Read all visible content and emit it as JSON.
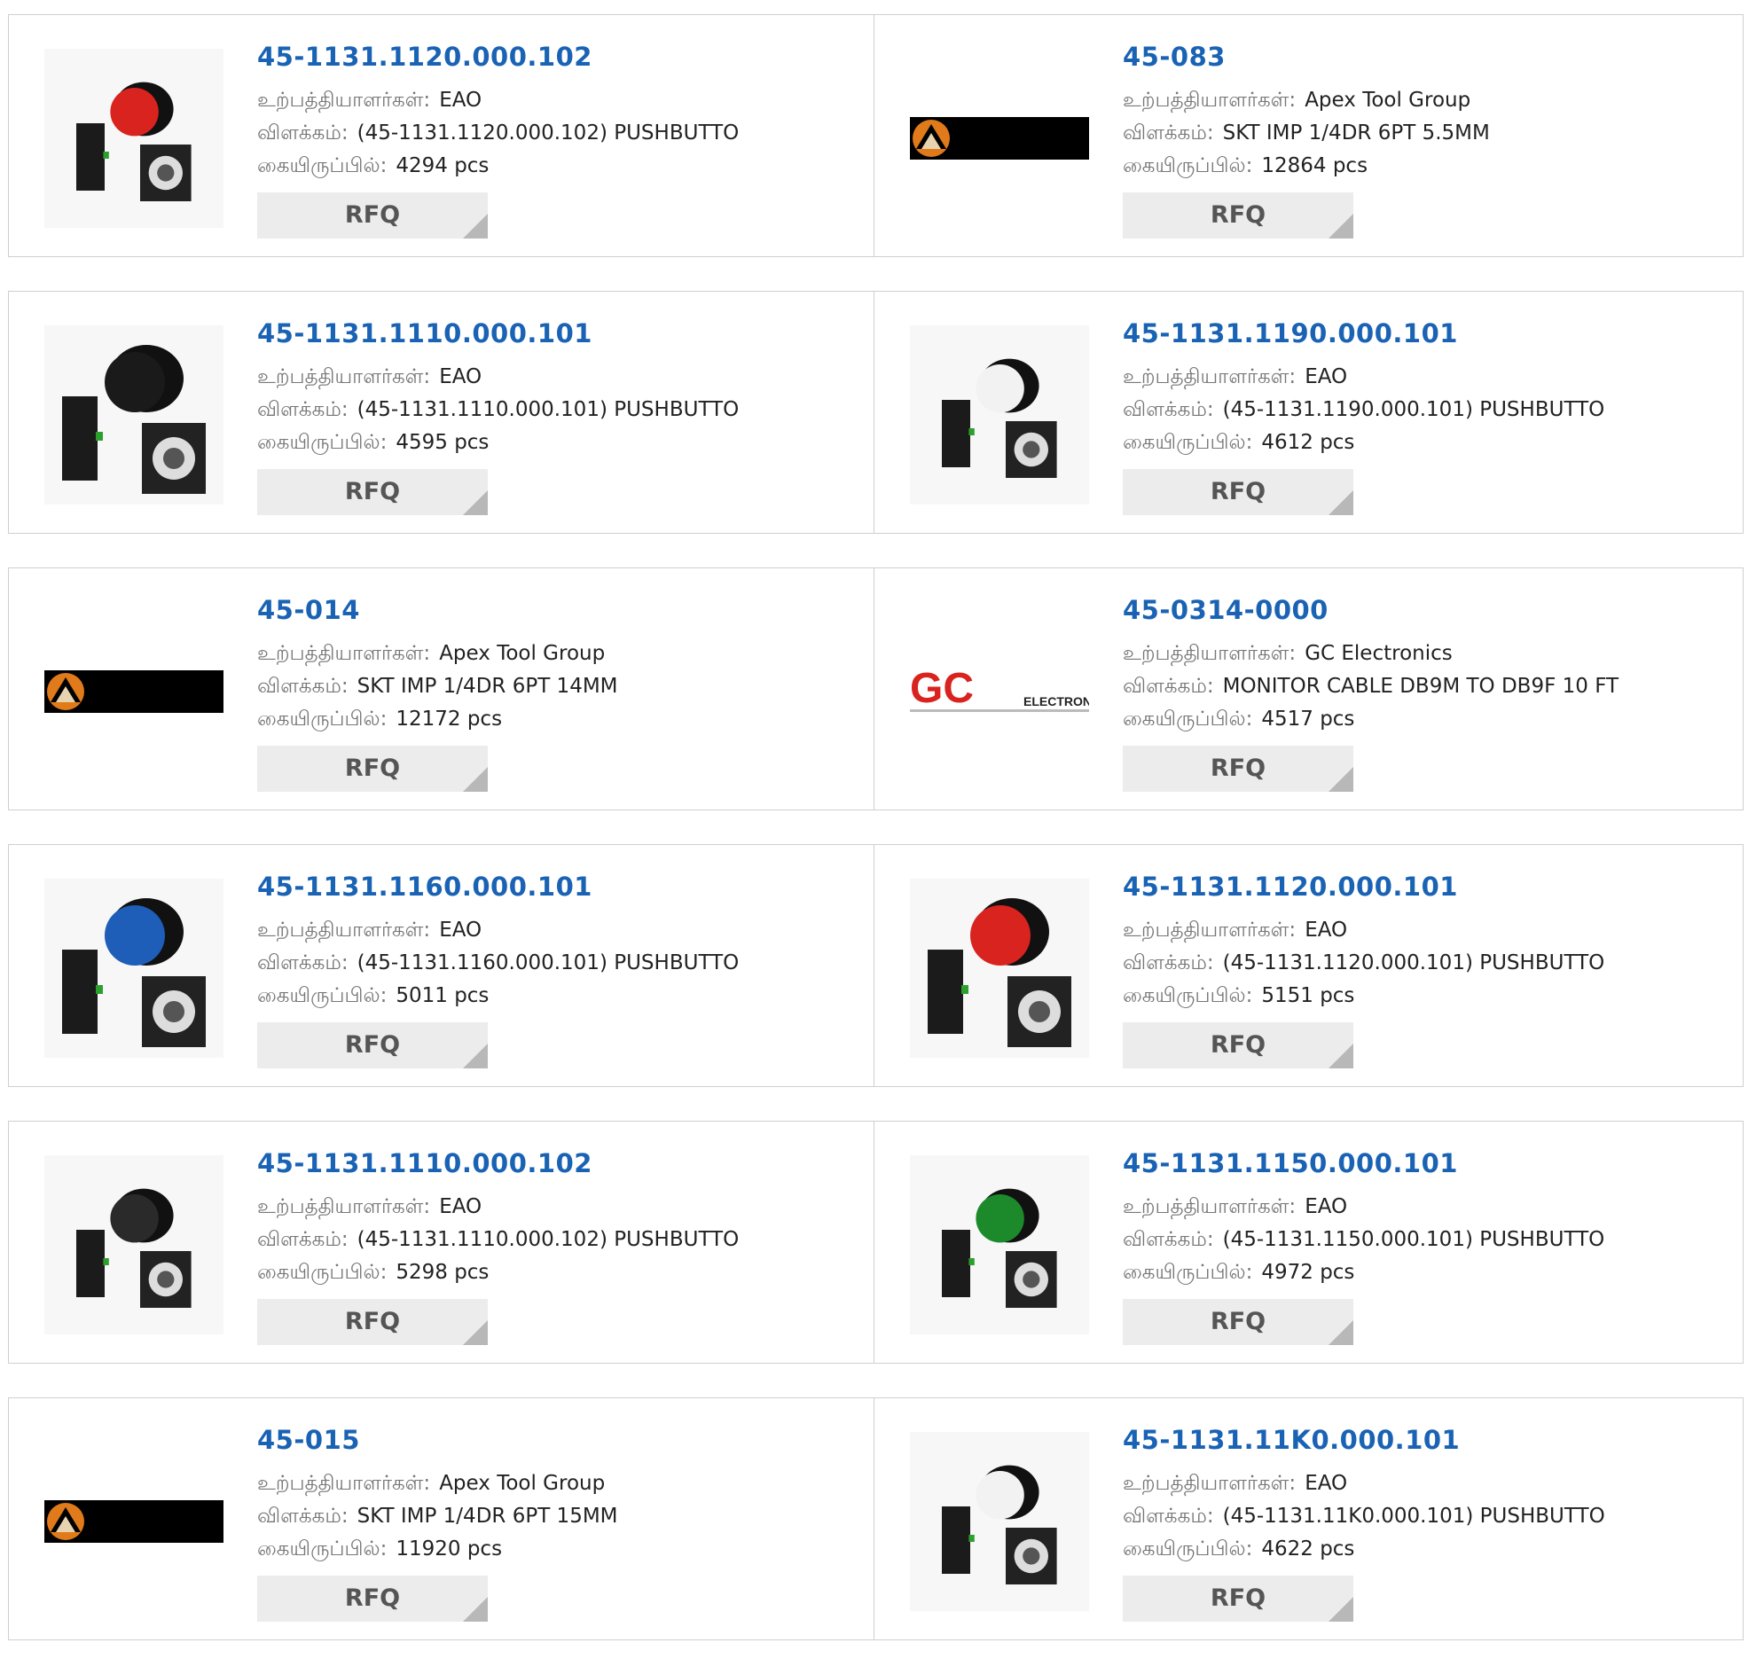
{
  "labels": {
    "manufacturer": "உற்பத்தியாளர்கள்:",
    "description": "விளக்கம்:",
    "stock": "கையிருப்பில்:",
    "rfq": "RFQ"
  },
  "products": [
    {
      "part": "45-1131.1120.000.102",
      "manufacturer": "EAO",
      "description": "(45-1131.1120.000.102) PUSHBUTTO",
      "stock": "4294 pcs",
      "image": "pushbutton-red-small"
    },
    {
      "part": "45-083",
      "manufacturer": "Apex Tool Group",
      "description": "SKT IMP 1/4DR 6PT 5.5MM",
      "stock": "12864 pcs",
      "image": "apex-logo"
    },
    {
      "part": "45-1131.1110.000.101",
      "manufacturer": "EAO",
      "description": "(45-1131.1110.000.101) PUSHBUTTO",
      "stock": "4595 pcs",
      "image": "pushbutton-black"
    },
    {
      "part": "45-1131.1190.000.101",
      "manufacturer": "EAO",
      "description": "(45-1131.1190.000.101) PUSHBUTTO",
      "stock": "4612 pcs",
      "image": "pushbutton-white-small"
    },
    {
      "part": "45-014",
      "manufacturer": "Apex Tool Group",
      "description": "SKT IMP 1/4DR 6PT 14MM",
      "stock": "12172 pcs",
      "image": "apex-logo"
    },
    {
      "part": "45-0314-0000",
      "manufacturer": "GC Electronics",
      "description": "MONITOR CABLE DB9M TO DB9F 10 FT",
      "stock": "4517 pcs",
      "image": "gc-electronics-logo"
    },
    {
      "part": "45-1131.1160.000.101",
      "manufacturer": "EAO",
      "description": "(45-1131.1160.000.101) PUSHBUTTO",
      "stock": "5011 pcs",
      "image": "pushbutton-blue"
    },
    {
      "part": "45-1131.1120.000.101",
      "manufacturer": "EAO",
      "description": "(45-1131.1120.000.101) PUSHBUTTO",
      "stock": "5151 pcs",
      "image": "pushbutton-red"
    },
    {
      "part": "45-1131.1110.000.102",
      "manufacturer": "EAO",
      "description": "(45-1131.1110.000.102) PUSHBUTTO",
      "stock": "5298 pcs",
      "image": "pushbutton-black-small"
    },
    {
      "part": "45-1131.1150.000.101",
      "manufacturer": "EAO",
      "description": "(45-1131.1150.000.101) PUSHBUTTO",
      "stock": "4972 pcs",
      "image": "pushbutton-green-small"
    },
    {
      "part": "45-015",
      "manufacturer": "Apex Tool Group",
      "description": "SKT IMP 1/4DR 6PT 15MM",
      "stock": "11920 pcs",
      "image": "apex-logo"
    },
    {
      "part": "45-1131.11K0.000.101",
      "manufacturer": "EAO",
      "description": "(45-1131.11K0.000.101) PUSHBUTTO",
      "stock": "4622 pcs",
      "image": "pushbutton-white-small"
    }
  ],
  "colors": {
    "link": "#1a63b4",
    "label": "#777777",
    "rfq_bg": "#ececec",
    "border": "#cfcfcf"
  },
  "logo_text": {
    "gc": "GC",
    "gc_sub": "ELECTRONICS"
  }
}
